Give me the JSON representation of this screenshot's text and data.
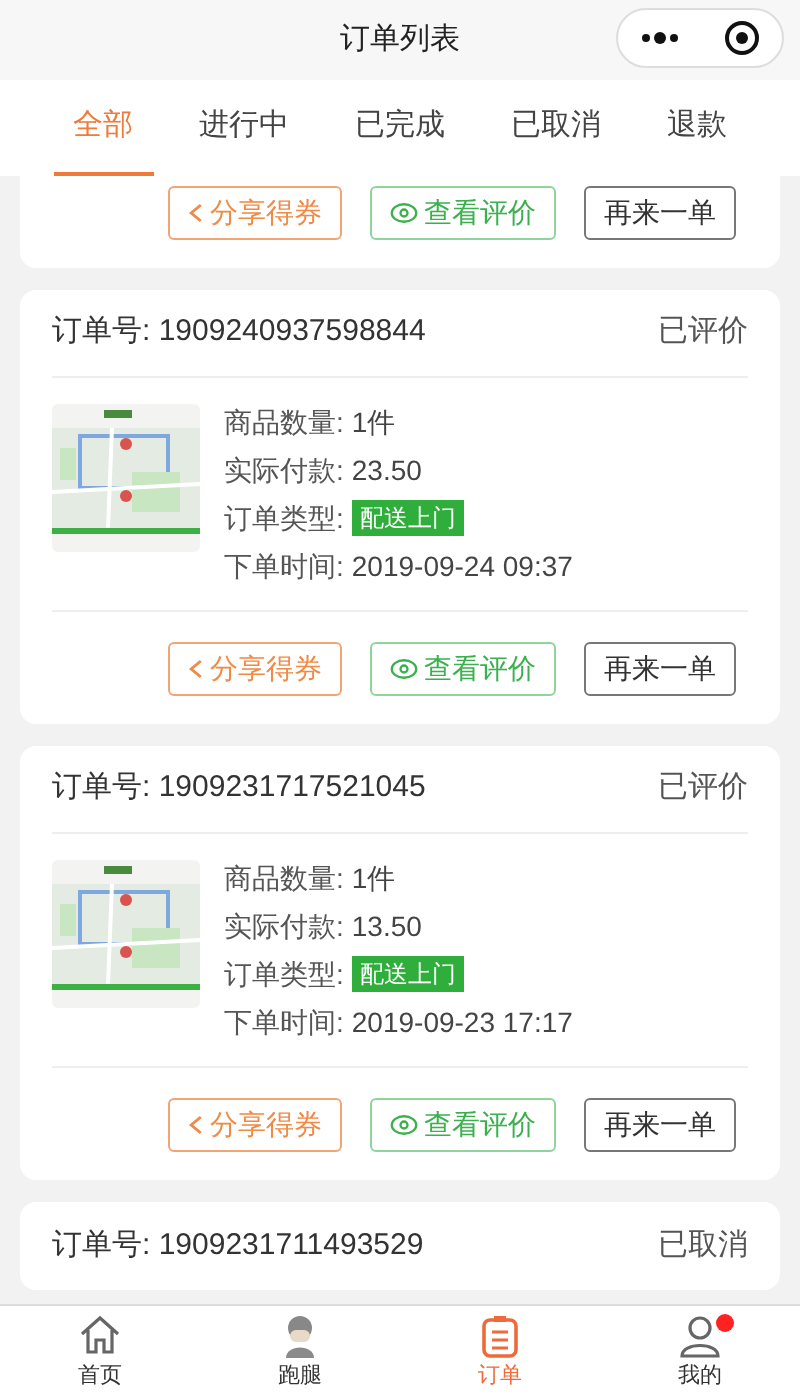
{
  "window": {
    "title": "订单列表"
  },
  "tabs": [
    {
      "label": "全部",
      "selected": true
    },
    {
      "label": "进行中",
      "selected": false
    },
    {
      "label": "已完成",
      "selected": false
    },
    {
      "label": "已取消",
      "selected": false
    },
    {
      "label": "退款",
      "selected": false
    }
  ],
  "orders": [
    {
      "buttons": [
        {
          "kind": "share",
          "label": "分享得券"
        },
        {
          "kind": "review",
          "label": "查看评价"
        },
        {
          "kind": "reorder",
          "label": "再来一单"
        }
      ]
    },
    {
      "order_no_label": "订单号:",
      "order_no": "1909240937598844",
      "status": "已评价",
      "thumbnail": {
        "kind": "picture"
      },
      "details": [
        {
          "label": "商品数量:",
          "value": "1件",
          "kind": "text"
        },
        {
          "label": "实际付款:",
          "value": "23.50",
          "kind": "text"
        },
        {
          "label": "订单类型:",
          "value": "配送上门",
          "kind": "badge"
        },
        {
          "label": "下单时间:",
          "value": "2019-09-24 09:37",
          "kind": "text"
        }
      ],
      "buttons": [
        {
          "kind": "share",
          "label": "分享得券"
        },
        {
          "kind": "review",
          "label": "查看评价"
        },
        {
          "kind": "reorder",
          "label": "再来一单"
        }
      ]
    },
    {
      "order_no_label": "订单号:",
      "order_no": "1909231717521045",
      "status": "已评价",
      "thumbnail": {
        "kind": "picture"
      },
      "details": [
        {
          "label": "商品数量:",
          "value": "1件",
          "kind": "text"
        },
        {
          "label": "实际付款:",
          "value": "13.50",
          "kind": "text"
        },
        {
          "label": "订单类型:",
          "value": "配送上门",
          "kind": "badge"
        },
        {
          "label": "下单时间:",
          "value": "2019-09-23 17:17",
          "kind": "text"
        }
      ],
      "buttons": [
        {
          "kind": "share",
          "label": "分享得券"
        },
        {
          "kind": "review",
          "label": "查看评价"
        },
        {
          "kind": "reorder",
          "label": "再来一单"
        }
      ]
    },
    {
      "order_no_label": "订单号:",
      "order_no": "1909231711493529",
      "status": "已取消"
    }
  ],
  "tab_bar": [
    {
      "label": "首页",
      "kind": "home",
      "selected": false,
      "dot": false
    },
    {
      "label": "跑腿",
      "kind": "courier",
      "selected": false,
      "dot": false
    },
    {
      "label": "订单",
      "kind": "orders",
      "selected": true,
      "dot": false
    },
    {
      "label": "我的",
      "kind": "profile",
      "selected": false,
      "dot": true
    }
  ]
}
